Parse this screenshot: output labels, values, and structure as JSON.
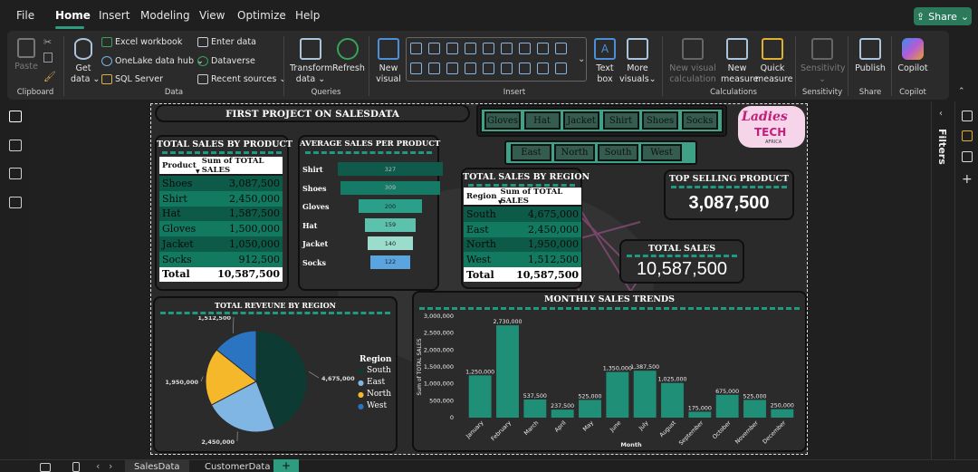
{
  "menu": {
    "items": [
      "File",
      "Home",
      "Insert",
      "Modeling",
      "View",
      "Optimize",
      "Help"
    ],
    "share": "Share"
  },
  "ribbon": {
    "clipboard": {
      "paste": "Paste",
      "label": "Clipboard"
    },
    "data": {
      "get_data": "Get",
      "get_data2": "data",
      "excel": "Excel workbook",
      "onelake": "OneLake data hub",
      "sql": "SQL Server",
      "enter": "Enter data",
      "dataverse": "Dataverse",
      "recent": "Recent sources",
      "label": "Data"
    },
    "queries": {
      "transform": "Transform",
      "transform2": "data",
      "refresh": "Refresh",
      "label": "Queries"
    },
    "insert": {
      "new_visual": "New",
      "new_visual2": "visual",
      "text_box": "Text",
      "text_box2": "box",
      "more_visuals": "More",
      "more_visuals2": "visuals",
      "label": "Insert"
    },
    "calculations": {
      "new_calc": "New visual",
      "new_calc2": "calculation",
      "new_measure": "New",
      "new_measure2": "measure",
      "quick": "Quick",
      "quick2": "measure",
      "label": "Calculations"
    },
    "sensitivity": {
      "btn": "Sensitivity",
      "label": "Sensitivity"
    },
    "share": {
      "publish": "Publish",
      "label": "Share"
    },
    "copilot": {
      "btn": "Copilot",
      "label": "Copilot"
    }
  },
  "report": {
    "title": "FIRST PROJECT ON SALESDATA",
    "logo": {
      "line1": "Ladies",
      "line2": "TECH",
      "line3": "AFRICA"
    },
    "product_slicer": [
      "Gloves",
      "Hat",
      "Jacket",
      "Shirt",
      "Shoes",
      "Socks"
    ],
    "region_slicer": [
      "East",
      "North",
      "South",
      "West"
    ],
    "sales_by_product": {
      "title": "TOTAL SALES BY PRODUCT",
      "col1": "Product",
      "col2": "Sum of TOTAL SALES",
      "rows": [
        [
          "Shoes",
          "3,087,500"
        ],
        [
          "Shirt",
          "2,450,000"
        ],
        [
          "Hat",
          "1,587,500"
        ],
        [
          "Gloves",
          "1,500,000"
        ],
        [
          "Jacket",
          "1,050,000"
        ],
        [
          "Socks",
          "912,500"
        ]
      ],
      "total": [
        "Total",
        "10,587,500"
      ]
    },
    "avg_sales": {
      "title": "AVERAGE SALES PER PRODUCT",
      "items": [
        [
          "Shirt",
          "327"
        ],
        [
          "Shoes",
          "309"
        ],
        [
          "Gloves",
          "200"
        ],
        [
          "Hat",
          "159"
        ],
        [
          "Jacket",
          "140"
        ],
        [
          "Socks",
          "122"
        ]
      ]
    },
    "sales_by_region": {
      "title": "TOTAL SALES BY REGION",
      "col1": "Region",
      "col2": "Sum of TOTAL SALES",
      "rows": [
        [
          "South",
          "4,675,000"
        ],
        [
          "East",
          "2,450,000"
        ],
        [
          "North",
          "1,950,000"
        ],
        [
          "West",
          "1,512,500"
        ]
      ],
      "total": [
        "Total",
        "10,587,500"
      ]
    },
    "top_product": {
      "title": "TOP SELLING PRODUCT",
      "value": "3,087,500"
    },
    "total_sales": {
      "title": "TOTAL SALES",
      "value": "10,587,500"
    },
    "revenue_region": {
      "title": "TOTAL REVEUNE BY REGION",
      "legend_title": "Region",
      "legend": [
        "South",
        "East",
        "North",
        "West"
      ]
    },
    "monthly": {
      "title": "MONTHLY SALES TRENDS"
    }
  },
  "pages": [
    "SalesData",
    "CustomerData"
  ],
  "right_pane": {
    "filters": "Filters"
  },
  "chart_data": [
    {
      "type": "pie",
      "title": "TOTAL REVEUNE BY REGION",
      "categories": [
        "South",
        "East",
        "North",
        "West"
      ],
      "values": [
        4675000,
        2450000,
        1950000,
        1512500
      ],
      "labels": [
        "4,675,000",
        "2,450,000",
        "1,950,000",
        "1,512,500"
      ],
      "colors": [
        "#0d3b34",
        "#7fb6e3",
        "#f5b82a",
        "#2a74c2"
      ]
    },
    {
      "type": "bar",
      "title": "MONTHLY SALES TRENDS",
      "xlabel": "Month",
      "ylabel": "Sum of TOTAL SALES",
      "categories": [
        "January",
        "February",
        "March",
        "April",
        "May",
        "June",
        "July",
        "August",
        "September",
        "October",
        "November",
        "December"
      ],
      "values": [
        1250000,
        2730000,
        537500,
        237500,
        525000,
        1350000,
        1387500,
        1025000,
        175000,
        675000,
        525000,
        250000
      ],
      "labels": [
        "1,250,000",
        "2,730,000",
        "537,500",
        "237,500",
        "525,000",
        "1,350,000",
        "1,387,500",
        "1,025,000",
        "175,000",
        "675,000",
        "525,000",
        "250,000"
      ],
      "yticks": [
        "0",
        "500,000",
        "1,000,000",
        "1,500,000",
        "2,000,000",
        "2,500,000",
        "3,000,000"
      ],
      "ylim": [
        0,
        3000000
      ],
      "color": "#1f8f78"
    }
  ]
}
